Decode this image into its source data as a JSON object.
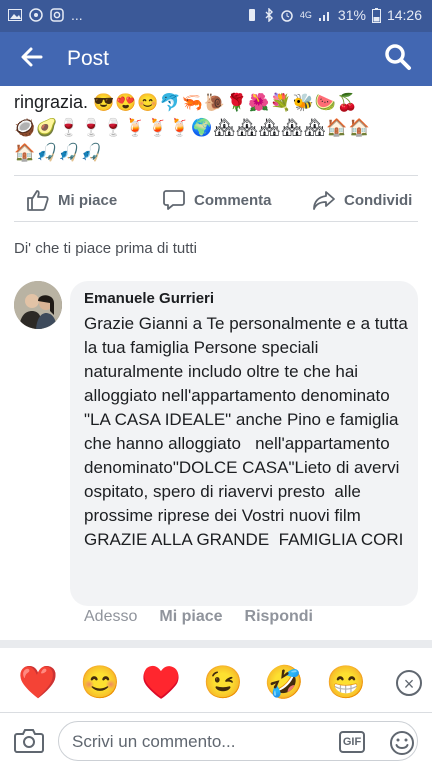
{
  "status_bar": {
    "left_icons": [
      "gallery-icon",
      "whatsapp-icon",
      "instagram-icon",
      "more-dots"
    ],
    "left_text": "...",
    "battery": "31%",
    "network": "4G",
    "time": "14:26"
  },
  "app_bar": {
    "title": "Post",
    "back_icon": "arrow-left-icon",
    "search_icon": "search-icon",
    "color": "#4267b2"
  },
  "post": {
    "text_tail": "ringrazia.",
    "emojis_line1": "😎😍😊🐬🦐🐌🌹🌺💐🐝🍉🍒",
    "emojis_line2": "🥥🥑🍷🍷🍷🍹🍹🍹🌍🏘🏘🏘🏘🏘🏠🏠",
    "emojis_line3": "🏠🎣🎣🎣"
  },
  "actions": {
    "like": "Mi piace",
    "comment": "Commenta",
    "share": "Condividi"
  },
  "first_like_prompt": "Di' che ti piace prima di tutti",
  "comment": {
    "author": "Emanuele Gurrieri",
    "text": "Grazie Gianni a Te personalmente e a tutta la tua famiglia Persone speciali naturalmente includo oltre te che hai alloggiato nell'appartamento denominato \"LA CASA IDEALE\" anche Pino e famiglia che hanno alloggiato   nell'appartamento denominato\"DOLCE CASA\"Lieto di avervi ospitato, spero di riavervi presto  alle prossime riprese dei Vostri nuovi film  GRAZIE ALLA GRANDE  FAMIGLIA CORI",
    "time": "Adesso",
    "like": "Mi piace",
    "reply": "Rispondi"
  },
  "reactions": [
    "❤️",
    "😊",
    "♥️",
    "😉",
    "🤣",
    "😁"
  ],
  "composer": {
    "placeholder": "Scrivi un commento...",
    "gif": "GIF"
  }
}
